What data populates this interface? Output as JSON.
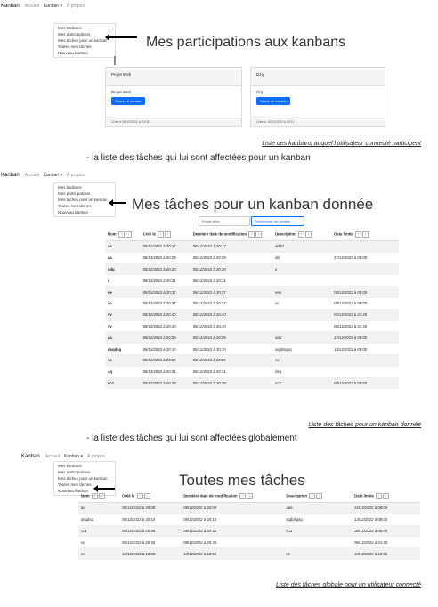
{
  "nav": {
    "brand": "Kanban",
    "accueil": "Accueil",
    "kanban": "Kanban ▾",
    "apropos": "À propos"
  },
  "menu": [
    "Mes kanbans",
    "Mes participations",
    "Mes tâches pour un kanban",
    "Toutes mes tâches",
    "Nouveau kanban"
  ],
  "section1": {
    "title": "Mes participations aux kanbans",
    "cards": [
      {
        "header": "Projet Web",
        "name": "Projet Web",
        "button": "Ouvrir ce kanban",
        "footer": "Créé le 08/12/2022 à 20:08"
      },
      {
        "header": "Dzq",
        "name": "dzq",
        "button": "Ouvrir ce kanban",
        "footer": "Créé le 10/12/2022 à 18:13"
      }
    ],
    "caption": "Liste des kanbans auquel l'utilisateur connecté participent"
  },
  "bullet1": "-     la liste des tâches qui lui sont affectées pour un kanban",
  "section2": {
    "title": "Mes tâches pour un kanban donnée",
    "search_value": "Projet Web",
    "search_button": "Rechercher un kanban",
    "headers": [
      "Nom",
      "Créé le",
      "Dernière date de modification",
      "Description",
      "Date limite"
    ],
    "rows": [
      [
        "aa",
        "08/12/2022 à 20:17",
        "08/12/2022 à 20:17",
        "dddd",
        ""
      ],
      [
        "aa",
        "08/12/2022 à 20:29",
        "08/12/2022 à 20:29",
        "dd",
        "27/12/2022 à 08:00"
      ],
      [
        "sdg",
        "08/12/2022 à 20:30",
        "08/12/2022 à 20:30",
        "s",
        ""
      ],
      [
        "s",
        "08/12/2022 à 20:31",
        "08/12/2022 à 20:31",
        "",
        ""
      ],
      [
        "ee",
        "08/12/2022 à 20:37",
        "08/12/2022 à 20:37",
        "eee",
        "09/12/2022 à 08:00"
      ],
      [
        "cc",
        "08/12/2022 à 20:37",
        "08/12/2022 à 20:37",
        "cc",
        "08/12/2022 à 08:00"
      ],
      [
        "vv",
        "08/12/2022 à 20:40",
        "08/12/2022 à 20:40",
        "",
        "09/12/2022 à 21:40"
      ],
      [
        "vv",
        "08/12/2022 à 20:40",
        "08/12/2022 à 20:40",
        "",
        "06/12/2022 à 21:40"
      ],
      [
        "aa",
        "08/12/2022 à 20:09",
        "08/12/2022 à 20:09",
        "aaa",
        "22/12/2022 à 08:00"
      ],
      [
        "dsqdsq",
        "08/12/2022 à 20:10",
        "08/12/2022 à 20:10",
        "sqddsqsq",
        "13/12/2022 à 08:00"
      ],
      [
        "ss",
        "08/12/2022 à 20:29",
        "08/12/2022 à 20:29",
        "ss",
        ""
      ],
      [
        "sq",
        "08/12/2022 à 20:31",
        "08/12/2022 à 20:31",
        "dsq",
        ""
      ],
      [
        "cc1",
        "08/12/2022 à 20:38",
        "08/12/2022 à 20:38",
        "cc3",
        "08/12/2022 à 08:00"
      ]
    ],
    "caption": "Liste des tâches pour un kanban donnée"
  },
  "bullet2": "-     la liste des tâches qui lui sont affectées globalement",
  "section3": {
    "title": "Toutes mes tâches",
    "headers": [
      "Nom",
      "Créé le",
      "Dernière date de modification",
      "Description",
      "Date limite"
    ],
    "rows": [
      [
        "aa",
        "08/12/2022 à 20:09",
        "08/12/2022 à 20:09",
        "aaa",
        "22/12/2022 à 08:00"
      ],
      [
        "dsqdsq",
        "08/12/2022 à 20:10",
        "08/12/2022 à 20:10",
        "sqddsqsq",
        "13/12/2022 à 08:00"
      ],
      [
        "cc1",
        "08/12/2022 à 20:38",
        "08/12/2022 à 20:38",
        "cc3",
        "08/12/2022 à 08:00"
      ],
      [
        "vv",
        "08/12/2022 à 20:40",
        "08/12/2022 à 20:40",
        "",
        "06/12/2022 à 21:40"
      ],
      [
        "ee",
        "10/12/2022 à 18:56",
        "10/12/2022 à 18:56",
        "ee",
        "10/12/2022 à 19:56"
      ]
    ],
    "caption": "Liste des tâches globale pour un utilisateur connecté"
  }
}
